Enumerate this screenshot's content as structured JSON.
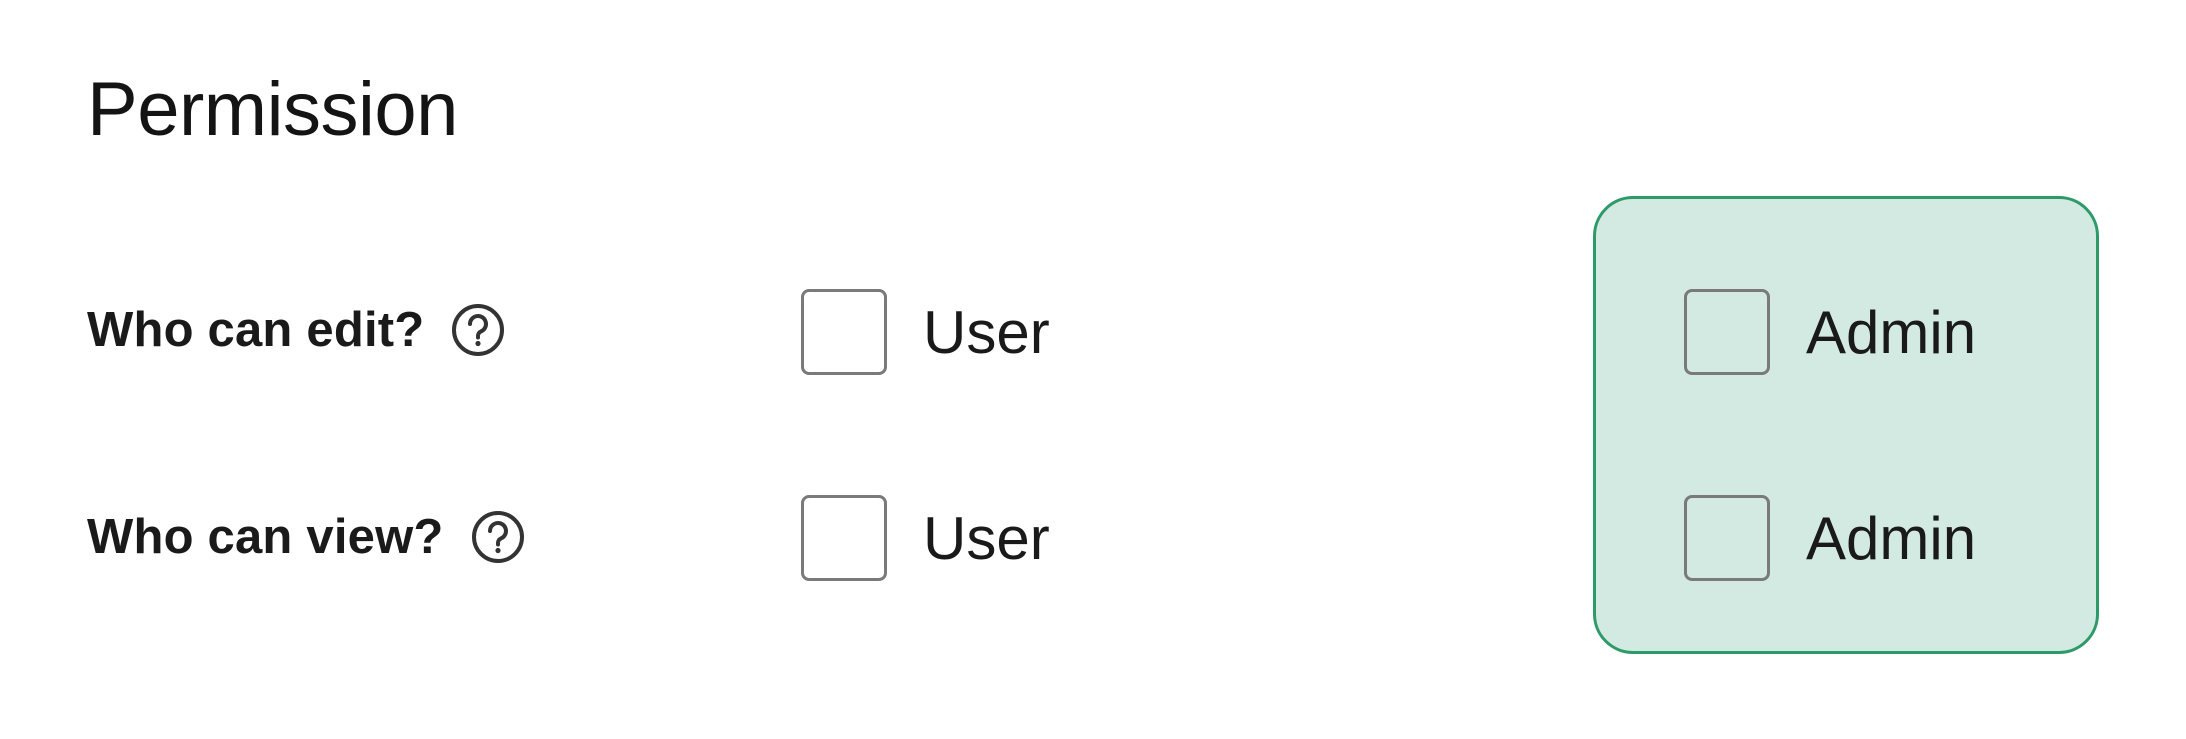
{
  "section": {
    "title": "Permission"
  },
  "rows": [
    {
      "label": "Who can edit?",
      "options": [
        {
          "label": "User",
          "checked": false
        },
        {
          "label": "Admin",
          "checked": false,
          "highlighted": true
        }
      ]
    },
    {
      "label": "Who can view?",
      "options": [
        {
          "label": "User",
          "checked": false
        },
        {
          "label": "Admin",
          "checked": false,
          "highlighted": true
        }
      ]
    }
  ],
  "icons": {
    "help": "question-circle-icon"
  },
  "colors": {
    "highlight_fill": "#d2eae1",
    "highlight_border": "#2e9a6a",
    "checkbox_border": "#7a7a7a",
    "text": "#1a1a1a"
  }
}
